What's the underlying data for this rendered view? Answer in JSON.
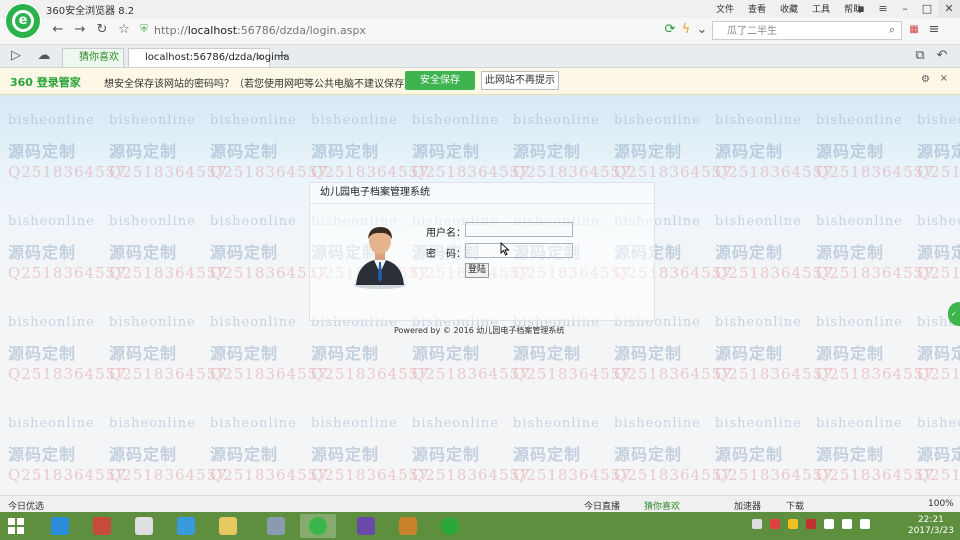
{
  "browser": {
    "title": "360安全浏览器 8.2",
    "menu": [
      "文件",
      "查看",
      "收藏",
      "工具",
      "帮助"
    ],
    "url_prefix": "http://",
    "url_host": "localhost",
    "url_rest": ":56786/dzda/login.aspx",
    "search_text": "瓜了二半生",
    "tabs": [
      {
        "label": "猜你喜欢"
      },
      {
        "label": "localhost:56786/dzda/login.a"
      }
    ]
  },
  "notification": {
    "brand": "360 登录管家",
    "message": "想安全保存该网站的密码吗？（若您使用网吧等公共电脑不建议保存）",
    "save_label": "安全保存",
    "never_label": "此网站不再提示"
  },
  "watermark": {
    "word": "bisheonline",
    "cn": "源码定制",
    "qq": "Q2518364557"
  },
  "login": {
    "title": "幼儿园电子档案管理系统",
    "username_label": "用户名：",
    "password_label": "密　码：",
    "button_label": "登陆",
    "footer": "Powered by © 2016 幼儿园电子档案管理系统"
  },
  "statusbar": {
    "left": "今日优选",
    "live": "今日直播",
    "guess": "猜你喜欢",
    "speed": "加速器",
    "download": "下载",
    "zoom": "100%"
  },
  "taskbar": {
    "time": "22:21",
    "date": "2017/3/23"
  }
}
